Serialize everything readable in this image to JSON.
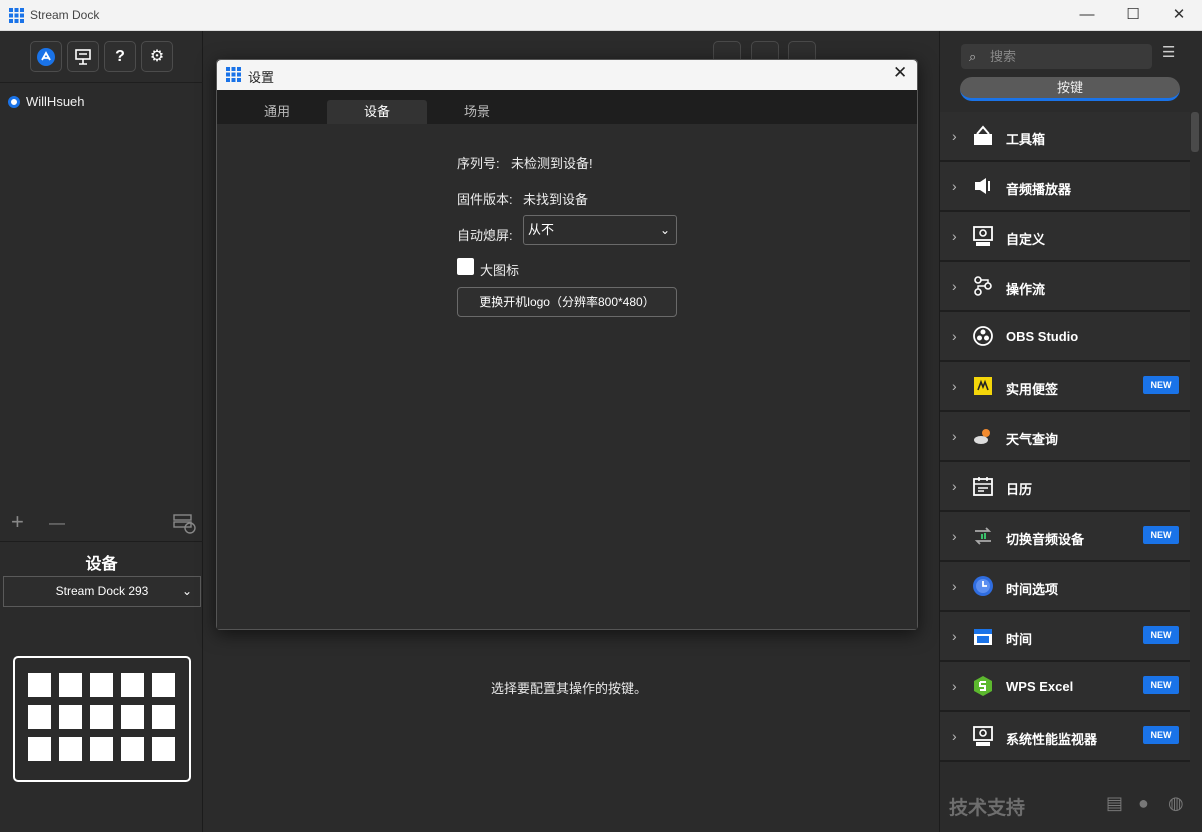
{
  "window": {
    "title": "Stream Dock",
    "min": "—",
    "max": "☐",
    "close": "✕"
  },
  "left": {
    "tools": [
      {
        "name": "store-icon",
        "glyph": "⌃"
      },
      {
        "name": "present-icon",
        "glyph": "▭"
      },
      {
        "name": "help-icon",
        "glyph": "?"
      },
      {
        "name": "gear-icon",
        "glyph": "⚙"
      }
    ],
    "profile": "WillHsueh",
    "add": "+",
    "remove": "—",
    "device_label": "设备",
    "device_select": "Stream Dock 293",
    "device_keys": 15
  },
  "center": {
    "hint": "选择要配置其操作的按键。"
  },
  "right": {
    "search_placeholder": "搜索",
    "tab": "按键",
    "plugins": [
      {
        "label": "工具箱",
        "icon": "toolbox-icon",
        "new": ""
      },
      {
        "label": "音频播放器",
        "icon": "speaker-icon",
        "new": ""
      },
      {
        "label": "自定义",
        "icon": "custom-icon",
        "new": ""
      },
      {
        "label": "操作流",
        "icon": "flow-icon",
        "new": ""
      },
      {
        "label": "OBS Studio",
        "icon": "obs-icon",
        "new": ""
      },
      {
        "label": "实用便签",
        "icon": "sticky-note-icon",
        "new": "NEW"
      },
      {
        "label": "天气查询",
        "icon": "weather-icon",
        "new": ""
      },
      {
        "label": "日历",
        "icon": "calendar-icon",
        "new": ""
      },
      {
        "label": "切换音频设备",
        "icon": "audio-switch-icon",
        "new": "NEW"
      },
      {
        "label": "时间选项",
        "icon": "clock-icon",
        "new": ""
      },
      {
        "label": "时间",
        "icon": "date-icon",
        "new": "NEW"
      },
      {
        "label": "WPS Excel",
        "icon": "excel-icon",
        "new": "NEW"
      },
      {
        "label": "系统性能监视器",
        "icon": "monitor-icon",
        "new": "NEW"
      }
    ],
    "support": "技术支持"
  },
  "dialog": {
    "title": "设置",
    "close": "✕",
    "tabs": [
      "通用",
      "设备",
      "场景"
    ],
    "active_tab": 1,
    "serial_label": "序列号:",
    "serial_value": "未检测到设备!",
    "firmware_label": "固件版本:",
    "firmware_value": "未找到设备",
    "autosleep_label": "自动熄屏:",
    "autosleep_value": "从不",
    "bigicon_label": "大图标",
    "logo_button": "更换开机logo（分辨率800*480）"
  },
  "colors": {
    "accent": "#1a73e8",
    "bg": "#2b2b2b",
    "new_badge": "#1a73e8"
  }
}
